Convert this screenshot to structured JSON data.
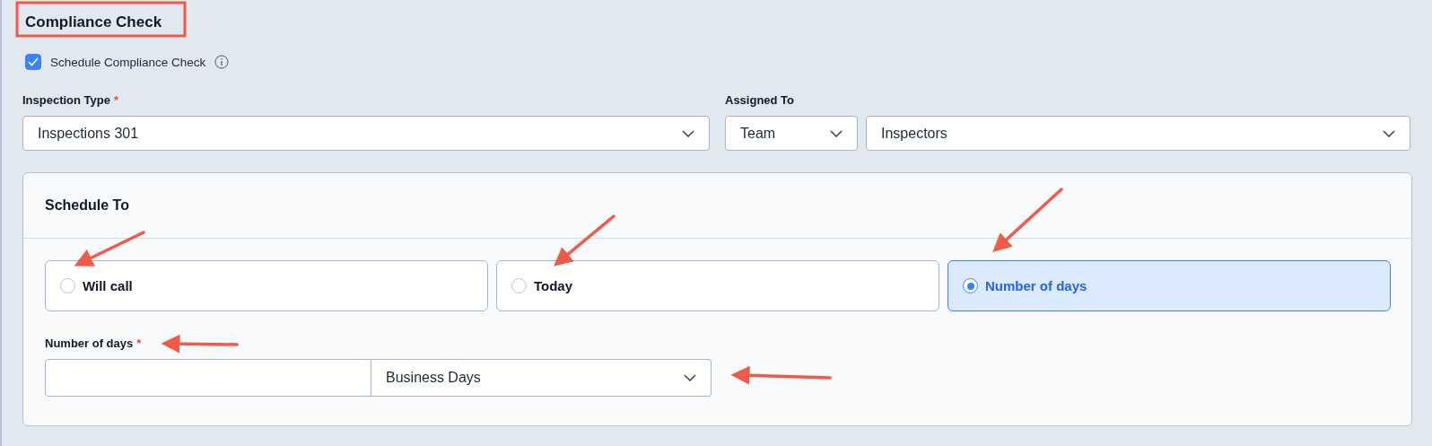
{
  "section": {
    "title": "Compliance Check"
  },
  "schedule_checkbox": {
    "label": "Schedule Compliance Check",
    "checked": true
  },
  "inspection_type": {
    "label": "Inspection Type",
    "required_mark": "*",
    "value": "Inspections 301"
  },
  "assigned_to": {
    "label": "Assigned To",
    "type_value": "Team",
    "value": "Inspectors"
  },
  "schedule_panel": {
    "title": "Schedule To",
    "options": [
      {
        "label": "Will call",
        "selected": false
      },
      {
        "label": "Today",
        "selected": false
      },
      {
        "label": "Number of days",
        "selected": true
      }
    ],
    "days_field": {
      "label": "Number of days",
      "required_mark": "*",
      "unit": "Business Days"
    }
  }
}
